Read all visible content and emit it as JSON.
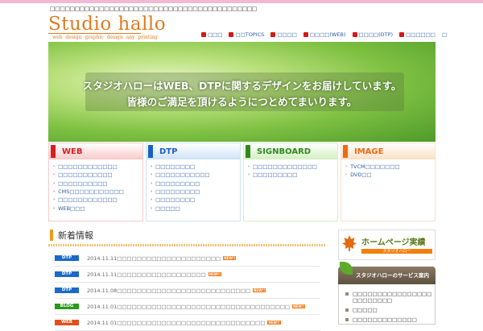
{
  "header": {
    "tagline": "□□□□□□□□□□□□□□□□□□□□□□□□□□□□□□□□□□□□□□□□□□",
    "logo": "Studio hallo",
    "logo_sub": "web design  graphic design  any printing"
  },
  "nav": [
    "□□□",
    "□□TOPICS",
    "□□□□",
    "□□□□(WEB)",
    "□□□□(DTP)",
    "□□□□□□",
    "□"
  ],
  "hero": {
    "line1": "スタジオハローはWEB、DTPに関するデザインをお届けしています。",
    "line2": "皆様のご満足を頂けるようにつとめてまいります。"
  },
  "categories": [
    {
      "title": "WEB",
      "color": "#d42020",
      "bg": "#f9c9c9",
      "items": [
        "□□□□□□□□□□□□",
        "□□□□□□□□□□□",
        "□□□□□□□□□□",
        "CMS□□□□□□□□□□□",
        "□□□□□□□□□□□□",
        "WEB□□□"
      ]
    },
    {
      "title": "DTP",
      "color": "#1a5fc4",
      "bg": "#cfe3f7",
      "items": [
        "□□□□□□□□",
        "□□□□□□□□□□□",
        "□□□□□□□□□",
        "□□□□□□□□□",
        "□□□□□□□□",
        "□□□□□"
      ]
    },
    {
      "title": "SIGNBOARD",
      "color": "#2e8a1e",
      "bg": "#d4f0c2",
      "items": [
        "□□□□□□□□□□□□□",
        "□□□□□□□□□"
      ]
    },
    {
      "title": "IMAGE",
      "color": "#ee6a10",
      "bg": "#fbe0c6",
      "items": [
        "TVCM□□□□□□□",
        "DVD□□"
      ]
    }
  ],
  "news": {
    "title": "新着情報",
    "new_label": "NEW!!",
    "items": [
      {
        "tag": "DTP",
        "color": "#1a6ac8",
        "text": "2014.11.11□□□□□□□□□□□□□□□□□□□□□"
      },
      {
        "tag": "DTP",
        "color": "#1a6ac8",
        "text": "2014.11.11□□□□□□□□□□□□□□□□□□"
      },
      {
        "tag": "DTP",
        "color": "#1a6ac8",
        "text": "2014.11.08□□□□□□□□□□□□□□□□□□□□□□□□□□□"
      },
      {
        "tag": "BLOG",
        "color": "#2a9a1a",
        "text": "2014.11.01□□□□□□□□□□□□□□□□□□□□□□□□□□□□□□□□□□□"
      },
      {
        "tag": "WEB",
        "color": "#e2501a",
        "text": "2014.11.01□□□□□□□□□□□□□□□□□□□□□□□□□□□□□□"
      }
    ]
  },
  "sidebar": {
    "banner_title": "ホームページ実績",
    "banner_sub": "スタジオハロー",
    "service_title": "スタジオハローのサービス案内",
    "service_items": [
      "□□□□□□□□□□□□□□□□ □□□□□□□□",
      "□□□□□",
      "□□□□□□□□□□□□□"
    ]
  }
}
